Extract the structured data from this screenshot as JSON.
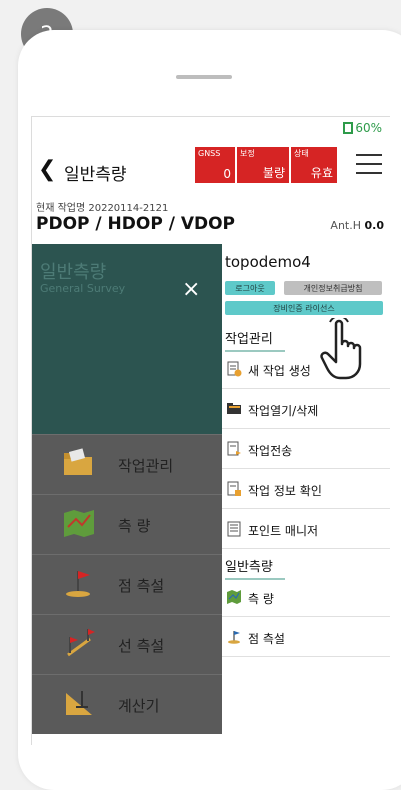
{
  "step": "2",
  "status_bar": {
    "battery": "60%"
  },
  "header": {
    "title": "일반측량",
    "status": [
      {
        "label": "GNSS",
        "value": "0"
      },
      {
        "label": "보정",
        "value": "불량"
      },
      {
        "label": "상태",
        "value": "유효"
      }
    ]
  },
  "info": {
    "job": "현재 작업명 20220114-2121",
    "dop": "PDOP  / HDOP  / VDOP",
    "anth_label": "Ant.H",
    "anth_value": "0.0"
  },
  "drawer": {
    "title": "일반측량",
    "subtitle": "General Survey",
    "close": "×",
    "items": [
      {
        "label": "작업관리",
        "icon": "folder-icon"
      },
      {
        "label": "측 량",
        "icon": "map-icon"
      },
      {
        "label": "점 측설",
        "icon": "flag-icon"
      },
      {
        "label": "선 측설",
        "icon": "line-flags-icon"
      },
      {
        "label": "계산기",
        "icon": "calculator-icon"
      }
    ]
  },
  "panel": {
    "user": "topodemo4",
    "logout": "로그아웃",
    "privacy": "개인정보취급방침",
    "license": "장비인증 라이선스",
    "sections": [
      {
        "title": "작업관리",
        "items": [
          {
            "label": "새 작업 생성",
            "icon": "new-doc-icon"
          },
          {
            "label": "작업열기/삭제",
            "icon": "open-folder-icon"
          },
          {
            "label": "작업전송",
            "icon": "send-doc-icon"
          },
          {
            "label": "작업 정보 확인",
            "icon": "info-doc-icon"
          },
          {
            "label": "포인트 매니저",
            "icon": "list-icon"
          }
        ]
      },
      {
        "title": "일반측량",
        "items": [
          {
            "label": "측 량",
            "icon": "map-icon"
          },
          {
            "label": "점 측설",
            "icon": "flag-icon"
          }
        ]
      }
    ]
  },
  "colors": {
    "status_red": "#d62424",
    "accent_teal": "#5ec9c9",
    "drawer_green": "#2c5450"
  }
}
